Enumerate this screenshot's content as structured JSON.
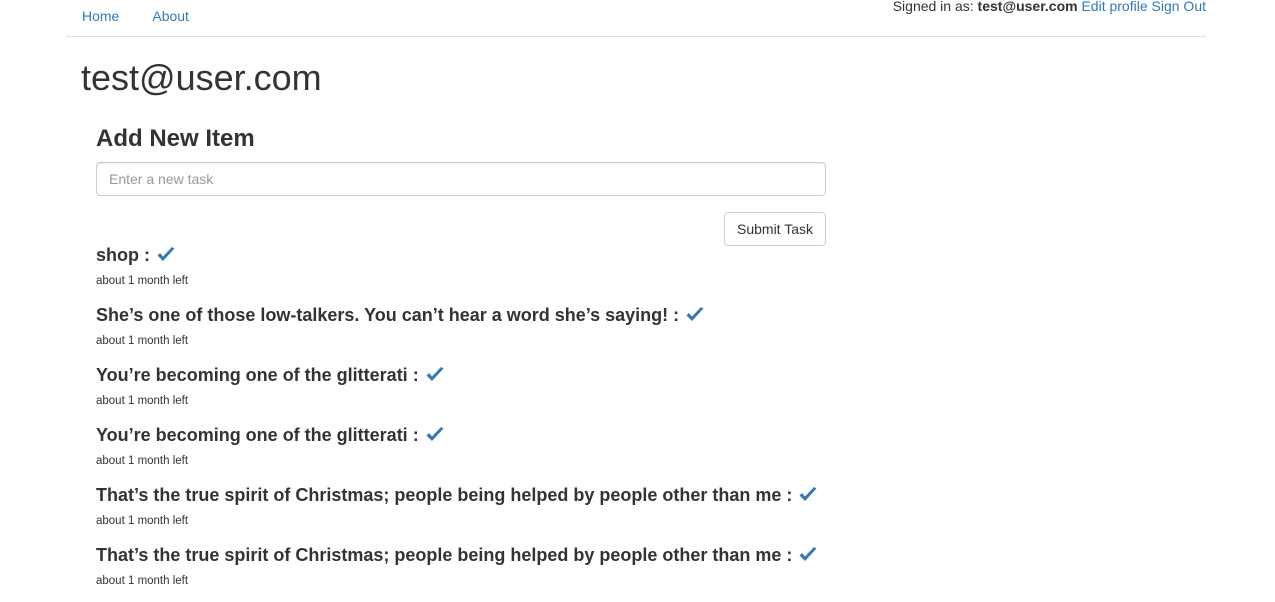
{
  "nav": {
    "links": [
      "Home",
      "About"
    ],
    "signed_in_label": "Signed in as: ",
    "user_email": "test@user.com",
    "edit_profile": "Edit profile",
    "sign_out": "Sign Out"
  },
  "page_title": "test@user.com",
  "form": {
    "heading": "Add New Item",
    "placeholder": "Enter a new task",
    "submit_label": "Submit Task"
  },
  "tasks": [
    {
      "title": "shop :",
      "time": "about 1 month left"
    },
    {
      "title": "She’s one of those low-talkers. You can’t hear a word she’s saying! :",
      "time": "about 1 month left"
    },
    {
      "title": "You’re becoming one of the glitterati :",
      "time": "about 1 month left"
    },
    {
      "title": "You’re becoming one of the glitterati :",
      "time": "about 1 month left"
    },
    {
      "title": "That’s the true spirit of Christmas; people being helped by people other than me :",
      "time": "about 1 month left"
    },
    {
      "title": "That’s the true spirit of Christmas; people being helped by people other than me :",
      "time": "about 1 month left"
    }
  ],
  "icons": {
    "complete": "check-icon"
  },
  "colors": {
    "link": "#337ab7",
    "text": "#333333",
    "border": "#cccccc"
  }
}
